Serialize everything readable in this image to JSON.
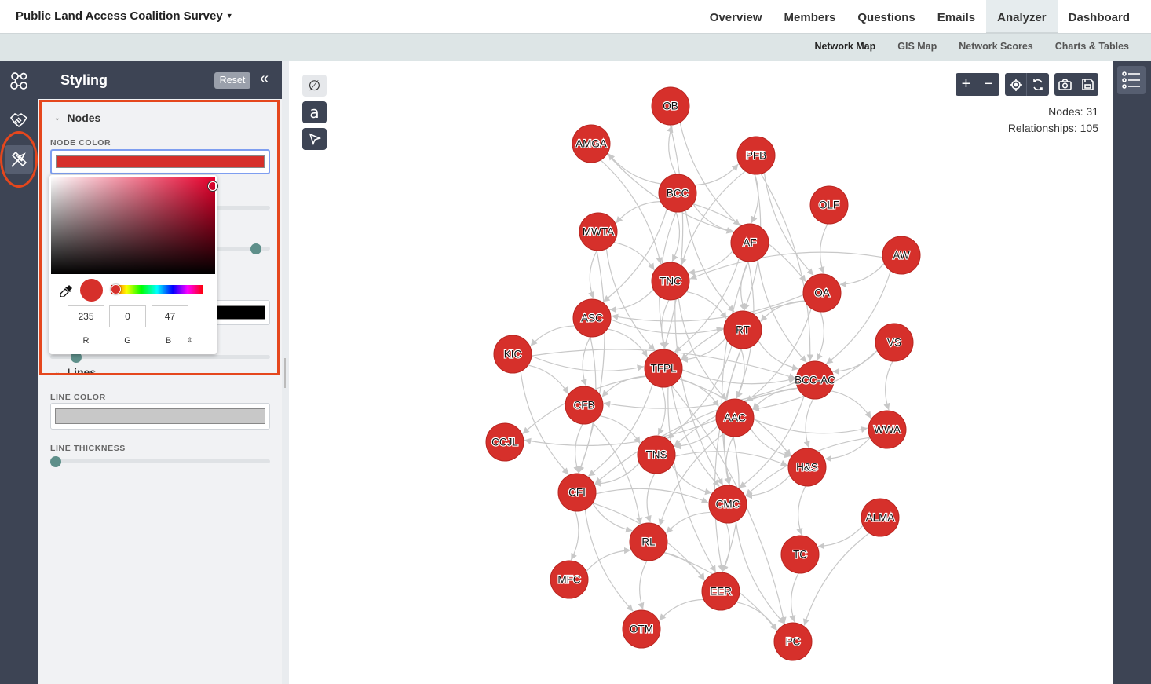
{
  "header": {
    "survey_title": "Public Land Access Coalition Survey",
    "tabs": [
      {
        "label": "Overview"
      },
      {
        "label": "Members"
      },
      {
        "label": "Questions"
      },
      {
        "label": "Emails"
      },
      {
        "label": "Analyzer"
      },
      {
        "label": "Dashboard"
      }
    ],
    "active_tab": "Analyzer"
  },
  "subnav": {
    "tabs": [
      {
        "label": "Network Map"
      },
      {
        "label": "GIS Map"
      },
      {
        "label": "Network Scores"
      },
      {
        "label": "Charts & Tables"
      }
    ],
    "active_tab": "Network Map"
  },
  "rail": {
    "items": [
      {
        "icon": "network-icon"
      },
      {
        "icon": "handshake-icon"
      },
      {
        "icon": "paint-tools-icon",
        "active": true
      }
    ]
  },
  "panel": {
    "title": "Styling",
    "reset_label": "Reset",
    "collapse_icon": "double-chevron-left-icon",
    "nodes_section": "Nodes",
    "node_color_label": "NODE COLOR",
    "node_color": "#d6302b",
    "lines_section": "Lines",
    "line_color_label": "LINE COLOR",
    "line_color": "#c8c8c8",
    "line_thickness_label": "LINE THICKNESS",
    "line_thickness_level": 0
  },
  "color_picker": {
    "hue_color": "#e8002c",
    "r": "235",
    "g": "0",
    "b": "47",
    "r_label": "R",
    "g_label": "G",
    "b_label": "B",
    "mode_toggle": "⇕"
  },
  "map": {
    "tools": [
      "clear-icon",
      "label-icon",
      "pointer-icon"
    ],
    "controls": [
      "zoom-in-icon",
      "zoom-out-icon",
      "center-icon",
      "refresh-icon",
      "camera-icon",
      "save-icon"
    ],
    "nodes_text": "Nodes: 31",
    "relationships_text": "Relationships: 105",
    "edge_color": "#c8c8c8",
    "node_fill": "#d6302b",
    "nodes": [
      {
        "id": "OB",
        "label": "OB"
      },
      {
        "id": "AMGA",
        "label": "AMGA"
      },
      {
        "id": "PFB",
        "label": "PFB"
      },
      {
        "id": "BCC",
        "label": "BCC"
      },
      {
        "id": "OLF",
        "label": "OLF"
      },
      {
        "id": "MWTA",
        "label": "MWTA"
      },
      {
        "id": "AF",
        "label": "AF"
      },
      {
        "id": "AW",
        "label": "AW"
      },
      {
        "id": "TNC",
        "label": "TNC"
      },
      {
        "id": "OA",
        "label": "OA"
      },
      {
        "id": "ASC",
        "label": "ASC"
      },
      {
        "id": "RT",
        "label": "RT"
      },
      {
        "id": "VS",
        "label": "VS"
      },
      {
        "id": "KIC",
        "label": "KIC"
      },
      {
        "id": "TFPL",
        "label": "TFPL"
      },
      {
        "id": "BCC-AC",
        "label": "BCC-AC"
      },
      {
        "id": "CFB",
        "label": "CFB"
      },
      {
        "id": "AAC",
        "label": "AAC"
      },
      {
        "id": "WWA",
        "label": "WWA"
      },
      {
        "id": "CCJL",
        "label": "CCJL"
      },
      {
        "id": "TNS",
        "label": "TNS"
      },
      {
        "id": "H&S",
        "label": "H&S"
      },
      {
        "id": "CFI",
        "label": "CFI"
      },
      {
        "id": "CMC",
        "label": "CMC"
      },
      {
        "id": "ALMA",
        "label": "ALMA"
      },
      {
        "id": "RL",
        "label": "RL"
      },
      {
        "id": "TC",
        "label": "TC"
      },
      {
        "id": "MFC",
        "label": "MFC"
      },
      {
        "id": "EER",
        "label": "EER"
      },
      {
        "id": "OTM",
        "label": "OTM"
      },
      {
        "id": "PC",
        "label": "PC"
      }
    ],
    "edges": [
      [
        "BCC",
        "OB"
      ],
      [
        "BCC",
        "PFB"
      ],
      [
        "BCC",
        "AMGA"
      ],
      [
        "BCC",
        "AF"
      ],
      [
        "BCC",
        "TNC"
      ],
      [
        "BCC",
        "MWTA"
      ],
      [
        "BCC",
        "OA"
      ],
      [
        "BCC",
        "RT"
      ],
      [
        "BCC",
        "ASC"
      ],
      [
        "BCC",
        "TFPL"
      ],
      [
        "OB",
        "TFPL"
      ],
      [
        "OB",
        "AF"
      ],
      [
        "AMGA",
        "TNC"
      ],
      [
        "AMGA",
        "AF"
      ],
      [
        "PFB",
        "AF"
      ],
      [
        "PFB",
        "OA"
      ],
      [
        "PFB",
        "RT"
      ],
      [
        "PFB",
        "TNC"
      ],
      [
        "PFB",
        "BCC-AC"
      ],
      [
        "OLF",
        "OA"
      ],
      [
        "MWTA",
        "TNC"
      ],
      [
        "MWTA",
        "TFPL"
      ],
      [
        "MWTA",
        "CFI"
      ],
      [
        "MWTA",
        "ASC"
      ],
      [
        "AF",
        "TNC"
      ],
      [
        "AF",
        "RT"
      ],
      [
        "AF",
        "AAC"
      ],
      [
        "AF",
        "BCC-AC"
      ],
      [
        "AF",
        "TFPL"
      ],
      [
        "AF",
        "CMC"
      ],
      [
        "AW",
        "OA"
      ],
      [
        "AW",
        "TNC"
      ],
      [
        "AW",
        "BCC-AC"
      ],
      [
        "TNC",
        "TFPL"
      ],
      [
        "TNC",
        "ASC"
      ],
      [
        "TNC",
        "CMC"
      ],
      [
        "TNC",
        "RT"
      ],
      [
        "TNC",
        "AAC"
      ],
      [
        "OA",
        "BCC-AC"
      ],
      [
        "OA",
        "RT"
      ],
      [
        "OA",
        "AAC"
      ],
      [
        "OA",
        "TFPL"
      ],
      [
        "OA",
        "ASC"
      ],
      [
        "ASC",
        "KIC"
      ],
      [
        "ASC",
        "TFPL"
      ],
      [
        "ASC",
        "CFB"
      ],
      [
        "ASC",
        "CFI"
      ],
      [
        "ASC",
        "RT"
      ],
      [
        "RT",
        "TFPL"
      ],
      [
        "RT",
        "BCC-AC"
      ],
      [
        "RT",
        "AAC"
      ],
      [
        "RT",
        "CMC"
      ],
      [
        "RT",
        "TNS"
      ],
      [
        "RT",
        "EER"
      ],
      [
        "VS",
        "BCC-AC"
      ],
      [
        "VS",
        "WWA"
      ],
      [
        "VS",
        "AAC"
      ],
      [
        "KIC",
        "TFPL"
      ],
      [
        "KIC",
        "BCC-AC"
      ],
      [
        "KIC",
        "CFI"
      ],
      [
        "KIC",
        "CFB"
      ],
      [
        "TFPL",
        "BCC-AC"
      ],
      [
        "TFPL",
        "AAC"
      ],
      [
        "TFPL",
        "CMC"
      ],
      [
        "TFPL",
        "TNS"
      ],
      [
        "TFPL",
        "CFB"
      ],
      [
        "TFPL",
        "H&S"
      ],
      [
        "TFPL",
        "EER"
      ],
      [
        "TFPL",
        "CFI"
      ],
      [
        "TFPL",
        "CCJL"
      ],
      [
        "TFPL",
        "PC"
      ],
      [
        "BCC-AC",
        "AAC"
      ],
      [
        "BCC-AC",
        "WWA"
      ],
      [
        "BCC-AC",
        "H&S"
      ],
      [
        "BCC-AC",
        "CMC"
      ],
      [
        "BCC-AC",
        "TNS"
      ],
      [
        "BCC-AC",
        "CFB"
      ],
      [
        "BCC-AC",
        "CFI"
      ],
      [
        "CFB",
        "TNS"
      ],
      [
        "CFB",
        "CFI"
      ],
      [
        "CFB",
        "RL"
      ],
      [
        "AAC",
        "WWA"
      ],
      [
        "AAC",
        "TNS"
      ],
      [
        "AAC",
        "CMC"
      ],
      [
        "AAC",
        "CCJL"
      ],
      [
        "AAC",
        "H&S"
      ],
      [
        "AAC",
        "EER"
      ],
      [
        "AAC",
        "RL"
      ],
      [
        "WWA",
        "H&S"
      ],
      [
        "WWA",
        "CMC"
      ],
      [
        "TNS",
        "CFI"
      ],
      [
        "TNS",
        "CMC"
      ],
      [
        "TNS",
        "H&S"
      ],
      [
        "TNS",
        "RL"
      ],
      [
        "H&S",
        "CMC"
      ],
      [
        "H&S",
        "TC"
      ],
      [
        "CFI",
        "CMC"
      ],
      [
        "CFI",
        "RL"
      ],
      [
        "CFI",
        "MFC"
      ],
      [
        "CFI",
        "OTM"
      ],
      [
        "CFI",
        "EER"
      ],
      [
        "CMC",
        "RL"
      ],
      [
        "CMC",
        "EER"
      ],
      [
        "CMC",
        "PC"
      ],
      [
        "ALMA",
        "TC"
      ],
      [
        "ALMA",
        "PC"
      ],
      [
        "RL",
        "EER"
      ],
      [
        "RL",
        "OTM"
      ],
      [
        "RL",
        "PC"
      ],
      [
        "TC",
        "PC"
      ],
      [
        "EER",
        "PC"
      ],
      [
        "EER",
        "OTM"
      ],
      [
        "MFC",
        "RL"
      ]
    ]
  }
}
